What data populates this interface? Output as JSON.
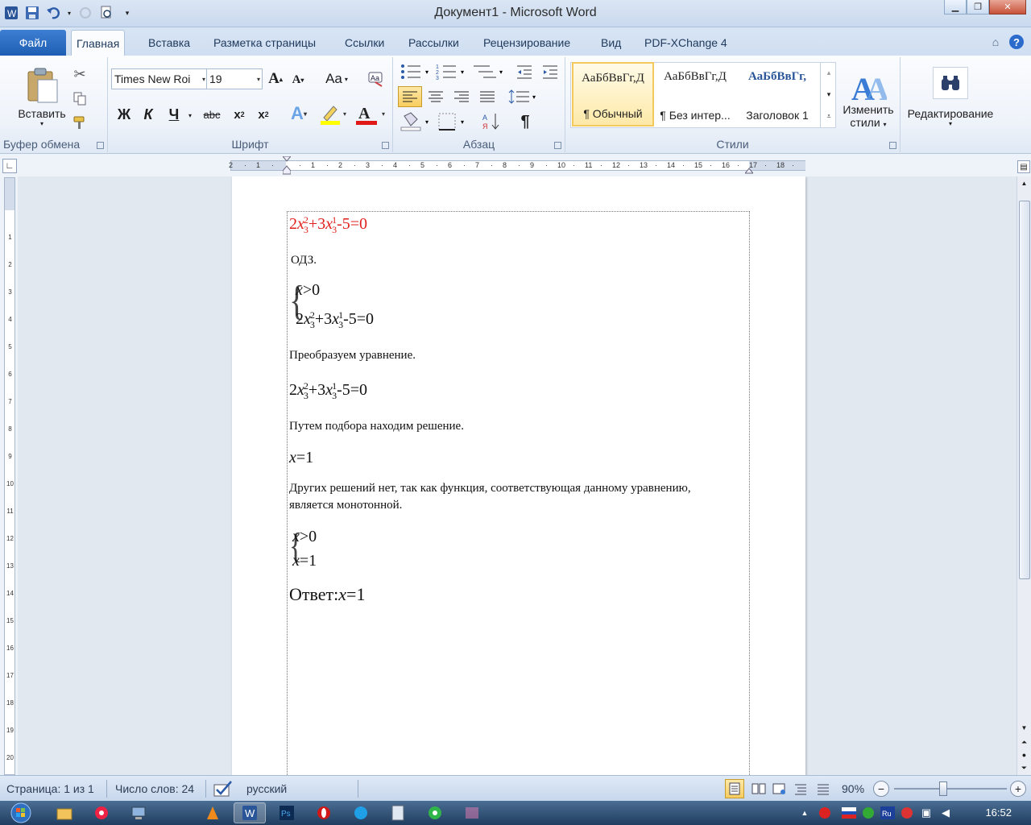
{
  "window": {
    "title": "Документ1  -  Microsoft Word"
  },
  "tabs": [
    {
      "label": "Главная",
      "active": true
    },
    {
      "label": "Вставка"
    },
    {
      "label": "Разметка страницы"
    },
    {
      "label": "Ссылки"
    },
    {
      "label": "Рассылки"
    },
    {
      "label": "Рецензирование"
    },
    {
      "label": "Вид"
    },
    {
      "label": "PDF-XChange 4"
    }
  ],
  "file_tab": "Файл",
  "ribbon": {
    "clipboard": {
      "paste_label": "Вставить",
      "group_label": "Буфер обмена"
    },
    "font": {
      "name": "Times New Roi",
      "size": "19",
      "group_label": "Шрифт",
      "bold": "Ж",
      "italic": "К",
      "underline": "Ч",
      "strike": "abc",
      "case": "Aa"
    },
    "paragraph": {
      "group_label": "Абзац"
    },
    "styles": {
      "group_label": "Стили",
      "items": [
        {
          "sample": "АаБбВвГг,Д",
          "name": "¶ Обычный"
        },
        {
          "sample": "АаБбВвГг,Д",
          "name": "¶ Без интер..."
        },
        {
          "sample": "АаБбВвГг,",
          "name": "Заголовок 1"
        }
      ],
      "change_line1": "Изменить",
      "change_line2": "стили"
    },
    "editing": {
      "label": "Редактирование"
    }
  },
  "document": {
    "odz": "ОДЗ.",
    "transform": "Преобразуем уравнение.",
    "selection": "Путем подбора находим решение.",
    "others_1": "Других решений нет, так как функция, соответствующая данному уравнению,",
    "others_2": "является монотонной.",
    "answer_label": "Ответ:",
    "x_gt_0": ">0",
    "x_eq_1": "=1",
    "eq_rest": "-5=0",
    "eq_2": "2",
    "eq_3": "3",
    "plus": "+3"
  },
  "status": {
    "page": "Страница: 1 из 1",
    "words": "Число слов: 24",
    "language": "русский",
    "zoom": "90%"
  },
  "taskbar": {
    "clock": "16:52"
  }
}
